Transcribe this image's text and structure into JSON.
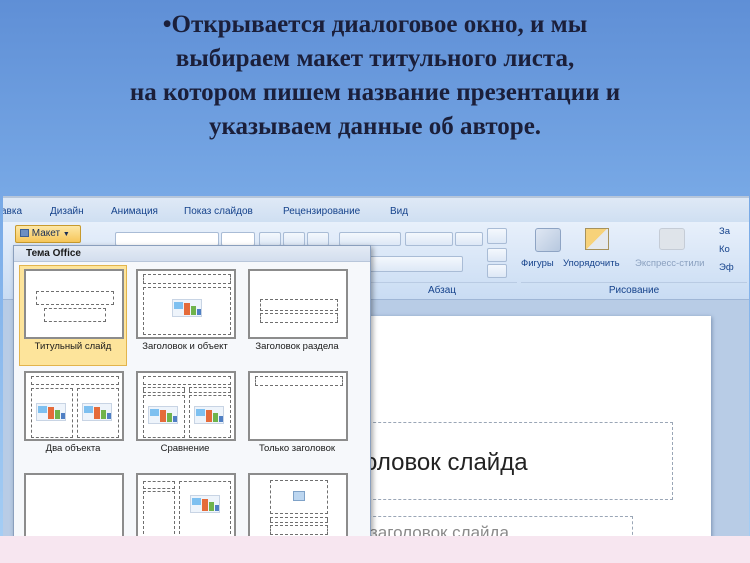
{
  "slide_heading": {
    "line1": "•Открывается диалоговое окно, и мы",
    "line2": "выбираем макет титульного листа,",
    "line3": "на котором пишем название презентации и",
    "line4": "указываем данные об авторе."
  },
  "menu_tabs": [
    "авка",
    "Дизайн",
    "Анимация",
    "Показ слайдов",
    "Рецензирование",
    "Вид"
  ],
  "ribbon": {
    "layout_button": "Макет",
    "paragraph_group": "Абзац",
    "drawing_group": "Рисование",
    "shapes_button": "Фигуры",
    "arrange_button": "Упорядочить",
    "quick_styles_button": "Экспресс-стили",
    "right_cut_1": "За",
    "right_cut_2": "Ко",
    "right_cut_3": "Эф"
  },
  "gallery": {
    "theme_title": "Тема Office",
    "layouts": [
      {
        "label": "Титульный слайд"
      },
      {
        "label": "Заголовок и объект"
      },
      {
        "label": "Заголовок раздела"
      },
      {
        "label": "Два объекта"
      },
      {
        "label": "Сравнение"
      },
      {
        "label": "Только заголовок"
      }
    ]
  },
  "slide_canvas": {
    "title_placeholder": "оловок слайда",
    "subtitle_placeholder": "заголовок слайда"
  }
}
